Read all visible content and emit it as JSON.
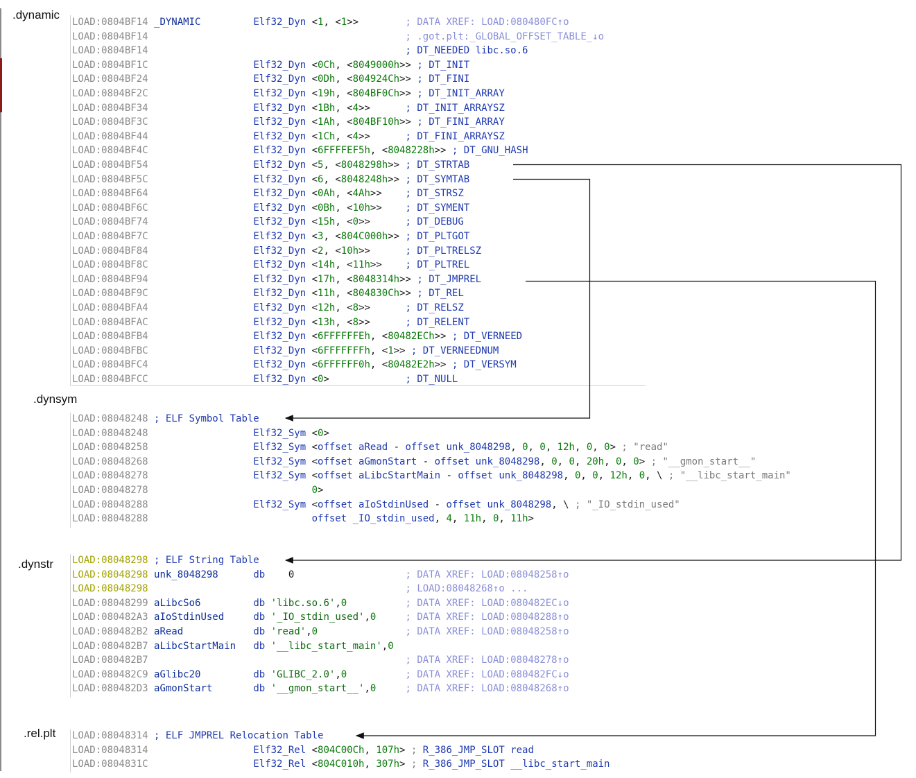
{
  "sections": {
    "dynamic": ".dynamic",
    "dynsym": ".dynsym",
    "dynstr": ".dynstr",
    "relplt": ".rel.plt"
  },
  "dynamic_rows": [
    {
      "addr": "LOAD:0804BF14",
      "label": "_DYNAMIC",
      "instr": "Elf32_Dyn <1, <1>>",
      "comment": "; DATA XREF: LOAD:080480FC↑o"
    },
    {
      "addr": "LOAD:0804BF14",
      "label": "",
      "instr": "",
      "comment": "; .got.plt:_GLOBAL_OFFSET_TABLE_↓o"
    },
    {
      "addr": "LOAD:0804BF14",
      "label": "",
      "instr": "",
      "comment": "; DT_NEEDED libc.so.6"
    },
    {
      "addr": "LOAD:0804BF1C",
      "label": "",
      "instr": "Elf32_Dyn <0Ch, <8049000h>>",
      "comment": "; DT_INIT"
    },
    {
      "addr": "LOAD:0804BF24",
      "label": "",
      "instr": "Elf32_Dyn <0Dh, <804924Ch>>",
      "comment": "; DT_FINI"
    },
    {
      "addr": "LOAD:0804BF2C",
      "label": "",
      "instr": "Elf32_Dyn <19h, <804BF0Ch>>",
      "comment": "; DT_INIT_ARRAY"
    },
    {
      "addr": "LOAD:0804BF34",
      "label": "",
      "instr": "Elf32_Dyn <1Bh, <4>>",
      "comment": "; DT_INIT_ARRAYSZ"
    },
    {
      "addr": "LOAD:0804BF3C",
      "label": "",
      "instr": "Elf32_Dyn <1Ah, <804BF10h>>",
      "comment": "; DT_FINI_ARRAY"
    },
    {
      "addr": "LOAD:0804BF44",
      "label": "",
      "instr": "Elf32_Dyn <1Ch, <4>>",
      "comment": "; DT_FINI_ARRAYSZ"
    },
    {
      "addr": "LOAD:0804BF4C",
      "label": "",
      "instr": "Elf32_Dyn <6FFFFEF5h, <8048228h>>",
      "comment": "; DT_GNU_HASH"
    },
    {
      "addr": "LOAD:0804BF54",
      "label": "",
      "instr": "Elf32_Dyn <5, <8048298h>>",
      "comment": "; DT_STRTAB"
    },
    {
      "addr": "LOAD:0804BF5C",
      "label": "",
      "instr": "Elf32_Dyn <6, <8048248h>>",
      "comment": "; DT_SYMTAB"
    },
    {
      "addr": "LOAD:0804BF64",
      "label": "",
      "instr": "Elf32_Dyn <0Ah, <4Ah>>",
      "comment": "; DT_STRSZ"
    },
    {
      "addr": "LOAD:0804BF6C",
      "label": "",
      "instr": "Elf32_Dyn <0Bh, <10h>>",
      "comment": "; DT_SYMENT"
    },
    {
      "addr": "LOAD:0804BF74",
      "label": "",
      "instr": "Elf32_Dyn <15h, <0>>",
      "comment": "; DT_DEBUG"
    },
    {
      "addr": "LOAD:0804BF7C",
      "label": "",
      "instr": "Elf32_Dyn <3, <804C000h>>",
      "comment": "; DT_PLTGOT"
    },
    {
      "addr": "LOAD:0804BF84",
      "label": "",
      "instr": "Elf32_Dyn <2, <10h>>",
      "comment": "; DT_PLTRELSZ"
    },
    {
      "addr": "LOAD:0804BF8C",
      "label": "",
      "instr": "Elf32_Dyn <14h, <11h>>",
      "comment": "; DT_PLTREL"
    },
    {
      "addr": "LOAD:0804BF94",
      "label": "",
      "instr": "Elf32_Dyn <17h, <8048314h>>",
      "comment": "; DT_JMPREL"
    },
    {
      "addr": "LOAD:0804BF9C",
      "label": "",
      "instr": "Elf32_Dyn <11h, <804830Ch>>",
      "comment": "; DT_REL"
    },
    {
      "addr": "LOAD:0804BFA4",
      "label": "",
      "instr": "Elf32_Dyn <12h, <8>>",
      "comment": "; DT_RELSZ"
    },
    {
      "addr": "LOAD:0804BFAC",
      "label": "",
      "instr": "Elf32_Dyn <13h, <8>>",
      "comment": "; DT_RELENT"
    },
    {
      "addr": "LOAD:0804BFB4",
      "label": "",
      "instr": "Elf32_Dyn <6FFFFFFEh, <80482ECh>>",
      "comment": "; DT_VERNEED"
    },
    {
      "addr": "LOAD:0804BFBC",
      "label": "",
      "instr": "Elf32_Dyn <6FFFFFFFh, <1>>",
      "comment": "; DT_VERNEEDNUM"
    },
    {
      "addr": "LOAD:0804BFC4",
      "label": "",
      "instr": "Elf32_Dyn <6FFFFFF0h, <80482E2h>>",
      "comment": "; DT_VERSYM"
    },
    {
      "addr": "LOAD:0804BFCC",
      "label": "",
      "instr": "Elf32_Dyn <0>",
      "comment": "; DT_NULL"
    }
  ],
  "dynsym_rows": [
    {
      "addr": "LOAD:08048248",
      "text": "; ELF Symbol Table",
      "kind": "header"
    },
    {
      "addr": "LOAD:08048248",
      "text": "Elf32_Sym <0>",
      "kind": "instr"
    },
    {
      "addr": "LOAD:08048258",
      "text": "Elf32_Sym <offset aRead - offset unk_8048298, 0, 0, 12h, 0, 0> ; \"read\"",
      "kind": "instr"
    },
    {
      "addr": "LOAD:08048268",
      "text": "Elf32_Sym <offset aGmonStart - offset unk_8048298, 0, 0, 20h, 0, 0> ; \"__gmon_start__\"",
      "kind": "instr"
    },
    {
      "addr": "LOAD:08048278",
      "text": "Elf32_Sym <offset aLibcStartMain - offset unk_8048298, 0, 0, 12h, 0, \\ ; \"__libc_start_main\"",
      "kind": "instr"
    },
    {
      "addr": "LOAD:08048278",
      "text": "          0>",
      "kind": "instr"
    },
    {
      "addr": "LOAD:08048288",
      "text": "Elf32_Sym <offset aIoStdinUsed - offset unk_8048298, \\ ; \"_IO_stdin_used\"",
      "kind": "instr"
    },
    {
      "addr": "LOAD:08048288",
      "text": "          offset _IO_stdin_used, 4, 11h, 0, 11h>",
      "kind": "instr"
    }
  ],
  "dynstr_rows": [
    {
      "addr": "LOAD:08048298",
      "label": "",
      "instr": "; ELF String Table",
      "comment": "",
      "hl": true
    },
    {
      "addr": "LOAD:08048298",
      "label": "unk_8048298",
      "instr": "db    0",
      "comment": "; DATA XREF: LOAD:08048258↑o",
      "hl": true
    },
    {
      "addr": "LOAD:08048298",
      "label": "",
      "instr": "",
      "comment": "; LOAD:08048268↑o ...",
      "hl": true
    },
    {
      "addr": "LOAD:08048299",
      "label": "aLibcSo6",
      "instr": "db 'libc.so.6',0",
      "comment": "; DATA XREF: LOAD:080482EC↓o",
      "hl": false
    },
    {
      "addr": "LOAD:080482A3",
      "label": "aIoStdinUsed",
      "instr": "db '_IO_stdin_used',0",
      "comment": "; DATA XREF: LOAD:08048288↑o",
      "hl": false
    },
    {
      "addr": "LOAD:080482B2",
      "label": "aRead",
      "instr": "db 'read',0",
      "comment": "; DATA XREF: LOAD:08048258↑o",
      "hl": false
    },
    {
      "addr": "LOAD:080482B7",
      "label": "aLibcStartMain",
      "instr": "db '__libc_start_main',0",
      "comment": "",
      "hl": false
    },
    {
      "addr": "LOAD:080482B7",
      "label": "",
      "instr": "",
      "comment": "; DATA XREF: LOAD:08048278↑o",
      "hl": false
    },
    {
      "addr": "LOAD:080482C9",
      "label": "aGlibc20",
      "instr": "db 'GLIBC_2.0',0",
      "comment": "; DATA XREF: LOAD:080482FC↓o",
      "hl": false
    },
    {
      "addr": "LOAD:080482D3",
      "label": "aGmonStart",
      "instr": "db '__gmon_start__',0",
      "comment": "; DATA XREF: LOAD:08048268↑o",
      "hl": false
    }
  ],
  "relplt_rows": [
    {
      "addr": "LOAD:08048314",
      "text": "; ELF JMPREL Relocation Table",
      "kind": "header"
    },
    {
      "addr": "LOAD:08048314",
      "text": "Elf32_Rel <804C00Ch, 107h> ; R_386_JMP_SLOT read",
      "kind": "instr"
    },
    {
      "addr": "LOAD:0804831C",
      "text": "Elf32_Rel <804C010h, 307h> ; R_386_JMP_SLOT __libc_start_main",
      "kind": "instr"
    }
  ]
}
